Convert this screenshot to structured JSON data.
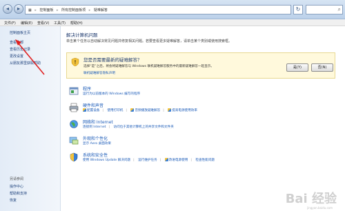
{
  "address": {
    "segments": [
      "控制面板",
      "所有控制面板项",
      "疑难解答"
    ],
    "separator": "▸"
  },
  "menu": [
    "文件(F)",
    "编辑(E)",
    "查看(V)",
    "工具(T)",
    "帮助(H)"
  ],
  "sidebar": {
    "items": [
      "控制面板主页",
      "查看全部",
      "查看历史记录",
      "更改设置",
      "从朋友那里获取帮助"
    ],
    "see_also_title": "另请参阅",
    "see_also": [
      "操作中心",
      "帮助和支持",
      "恢复"
    ]
  },
  "main": {
    "title": "解决计算机问题",
    "description": "单击某个任务以自动解决常见问题并修复相关问题。若要查看更多疑难解答，请单击某个类别或使用搜索框。"
  },
  "banner": {
    "title": "您是否需要最新的疑难解答？",
    "text": "选择“是”之后，将会将疑难解答与 Windows 联机疑难解答服务中的最新疑难解答一起显示。",
    "link": "联机疑难解答隐私声明",
    "yes": "是(Y)",
    "no": "否(N)"
  },
  "categories": [
    {
      "title": "程序",
      "links": [
        "运行为以前版本的 Windows 编写的程序"
      ]
    },
    {
      "title": "硬件和声音",
      "links": [
        "配置设备",
        "使用打印机",
        "音频播放疑难解答",
        "提高电源使用效率"
      ]
    },
    {
      "title": "网络和 Internet",
      "links": [
        "连接到 Internet",
        "访问位于其他计算机上的共享文件和文件夹"
      ]
    },
    {
      "title": "外观和个性化",
      "links": [
        "显示 Aero 桌面效果"
      ]
    },
    {
      "title": "系统和安全性",
      "links": [
        "使用 Windows Update 解决问题",
        "运行维护任务",
        "改进电源使用",
        "检查性能问题"
      ]
    }
  ],
  "watermark": "Bai 经验",
  "watermark_sub": "jingyan.baidu.com"
}
